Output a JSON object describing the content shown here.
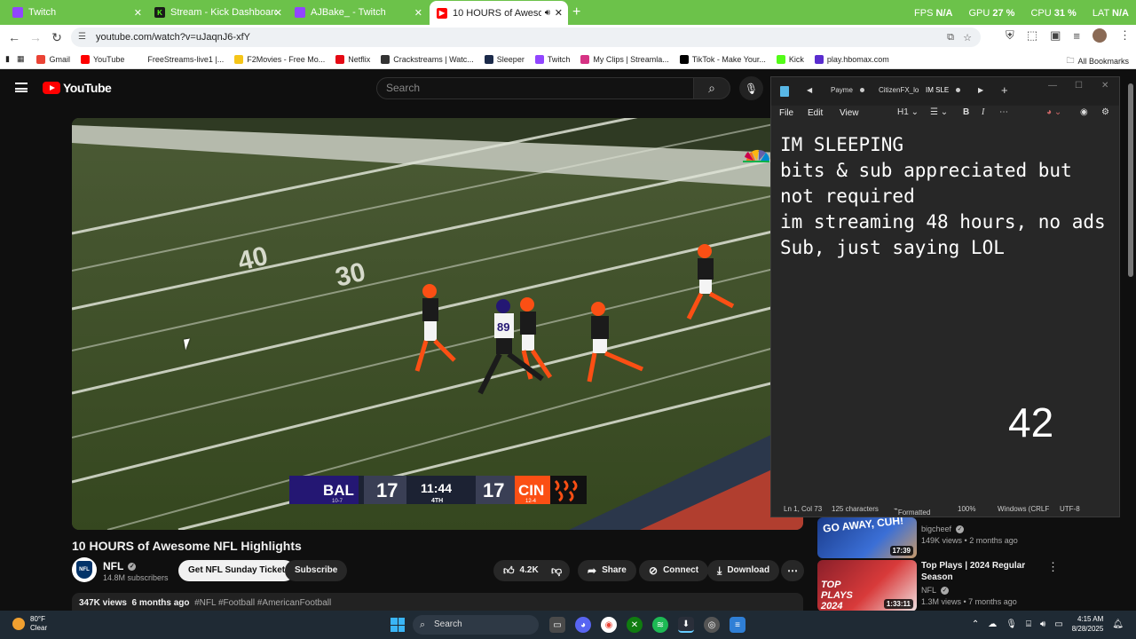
{
  "browser": {
    "tabs": [
      {
        "label": "Twitch",
        "favicon_color": "#9146ff",
        "active": false
      },
      {
        "label": "Stream - Kick Dashboard",
        "favicon_color": "#1a1a1a",
        "active": false
      },
      {
        "label": "AJBake_ - Twitch",
        "favicon_color": "#9146ff",
        "active": false
      },
      {
        "label": "10 HOURS of Awesome NFL",
        "favicon_color": "#ff0000",
        "active": true
      }
    ],
    "perf": {
      "fps_label": "FPS",
      "fps": "N/A",
      "gpu_label": "GPU",
      "gpu": "27 %",
      "cpu_label": "CPU",
      "cpu": "31 %",
      "lat_label": "LAT",
      "lat": "N/A"
    },
    "url": "youtube.com/watch?v=uJaqnJ6-xfY",
    "bookmarks": [
      {
        "label": "Gmail",
        "color": "#ea4335"
      },
      {
        "label": "YouTube",
        "color": "#ff0000"
      },
      {
        "label": "FreeStreams-live1 |...",
        "color": "#ffffff"
      },
      {
        "label": "F2Movies - Free Mo...",
        "color": "#f5c518"
      },
      {
        "label": "Netflix",
        "color": "#e50914"
      },
      {
        "label": "Crackstreams | Watc...",
        "color": "#333333"
      },
      {
        "label": "Sleeper",
        "color": "#1b2a4a"
      },
      {
        "label": "Twitch",
        "color": "#9146ff"
      },
      {
        "label": "My Clips | Streamla...",
        "color": "#d63384"
      },
      {
        "label": "TikTok - Make Your...",
        "color": "#000000"
      },
      {
        "label": "Kick",
        "color": "#53fc18"
      },
      {
        "label": "play.hbomax.com",
        "color": "#5a2dcf"
      }
    ],
    "all_bookmarks": "All Bookmarks"
  },
  "youtube": {
    "logo_text": "YouTube",
    "search_placeholder": "Search",
    "video": {
      "title": "10 HOURS of Awesome NFL Highlights",
      "channel": "NFL",
      "subscribers": "14.8M subscribers",
      "ticket_button": "Get NFL Sunday Ticket",
      "subscribe_button": "Subscribe",
      "likes": "4.2K",
      "share": "Share",
      "connect": "Connect",
      "download": "Download",
      "views": "347K views",
      "age": "6 months ago",
      "tags": "#NFL #Football #AmericanFootball"
    },
    "scorebug": {
      "away_team": "BAL",
      "away_record": "10-7",
      "away_score": "17",
      "clock": "11:44",
      "quarter": "4TH",
      "home_team": "CIN",
      "home_record": "12-4",
      "home_score": "17"
    },
    "field_numbers": {
      "left": "40",
      "right": "30"
    },
    "player_number": "89",
    "related": [
      {
        "thumb_text": "GO AWAY, CUH!",
        "duration": "17:39",
        "channel": "bigcheef",
        "views": "149K views",
        "age": "2 months ago"
      },
      {
        "title": "Top Plays | 2024 Regular Season",
        "thumb_text": "TOP PLAYS 2024",
        "duration": "1:33:11",
        "channel": "NFL",
        "views": "1.3M views",
        "age": "7 months ago"
      }
    ]
  },
  "notepad": {
    "tabs": [
      "Payme",
      "CitizenFX_lo",
      "IM SLE"
    ],
    "menu": [
      "File",
      "Edit",
      "View"
    ],
    "heading_dropdown": "H1",
    "content": "IM SLEEPING\nbits & sub appreciated but not required\nim streaming 48 hours, no ads Sub, just saying LOL",
    "counter": "42",
    "status": {
      "position": "Ln 1, Col 73",
      "chars": "125 characters",
      "format": "Formatted",
      "zoom": "100%",
      "line_ending": "Windows (CRLF",
      "encoding": "UTF-8"
    }
  },
  "taskbar": {
    "temp": "80°F",
    "condition": "Clear",
    "search": "Search",
    "time": "4:15 AM",
    "date": "8/28/2025"
  }
}
